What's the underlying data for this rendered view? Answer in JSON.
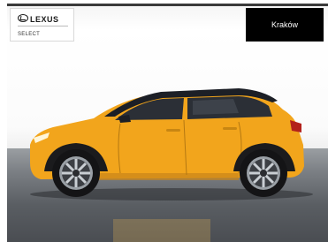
{
  "brand": {
    "logo_text": "LEXUS",
    "sub_label": "SELECT"
  },
  "location_button": {
    "label": "Kraków"
  },
  "vehicle": {
    "icon": "car-photo",
    "body_color": "#f2a51c",
    "roof_color": "#1c1f26"
  }
}
